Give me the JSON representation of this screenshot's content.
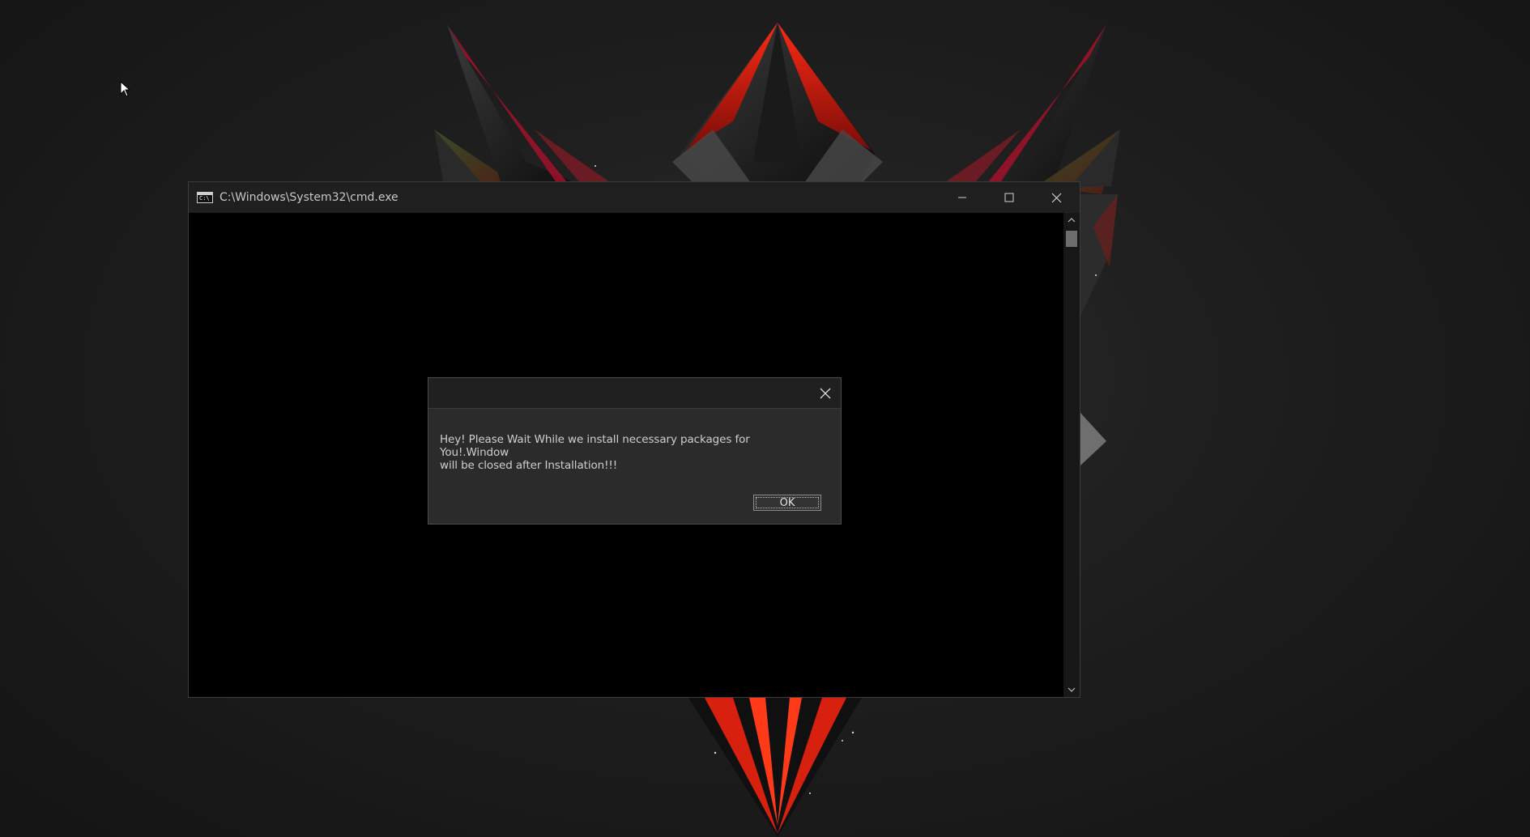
{
  "cmd_window": {
    "title": "C:\\Windows\\System32\\cmd.exe",
    "icon_text": "C:\\",
    "controls": {
      "minimize": "minimize-icon",
      "maximize": "maximize-icon",
      "close": "close-icon"
    }
  },
  "dialog": {
    "title": "",
    "message_line1": "Hey! Please Wait While we install necessary packages for You!.Window",
    "message_line2": "will be closed after Installation!!!",
    "ok_label": "OK"
  },
  "colors": {
    "desktop_bg": "#1e1e1e",
    "wallpaper_accent": "#e8261a",
    "titlebar": "#1f1f1f",
    "dialog_bg": "#2b2b2b",
    "text": "#cfcfcf"
  }
}
